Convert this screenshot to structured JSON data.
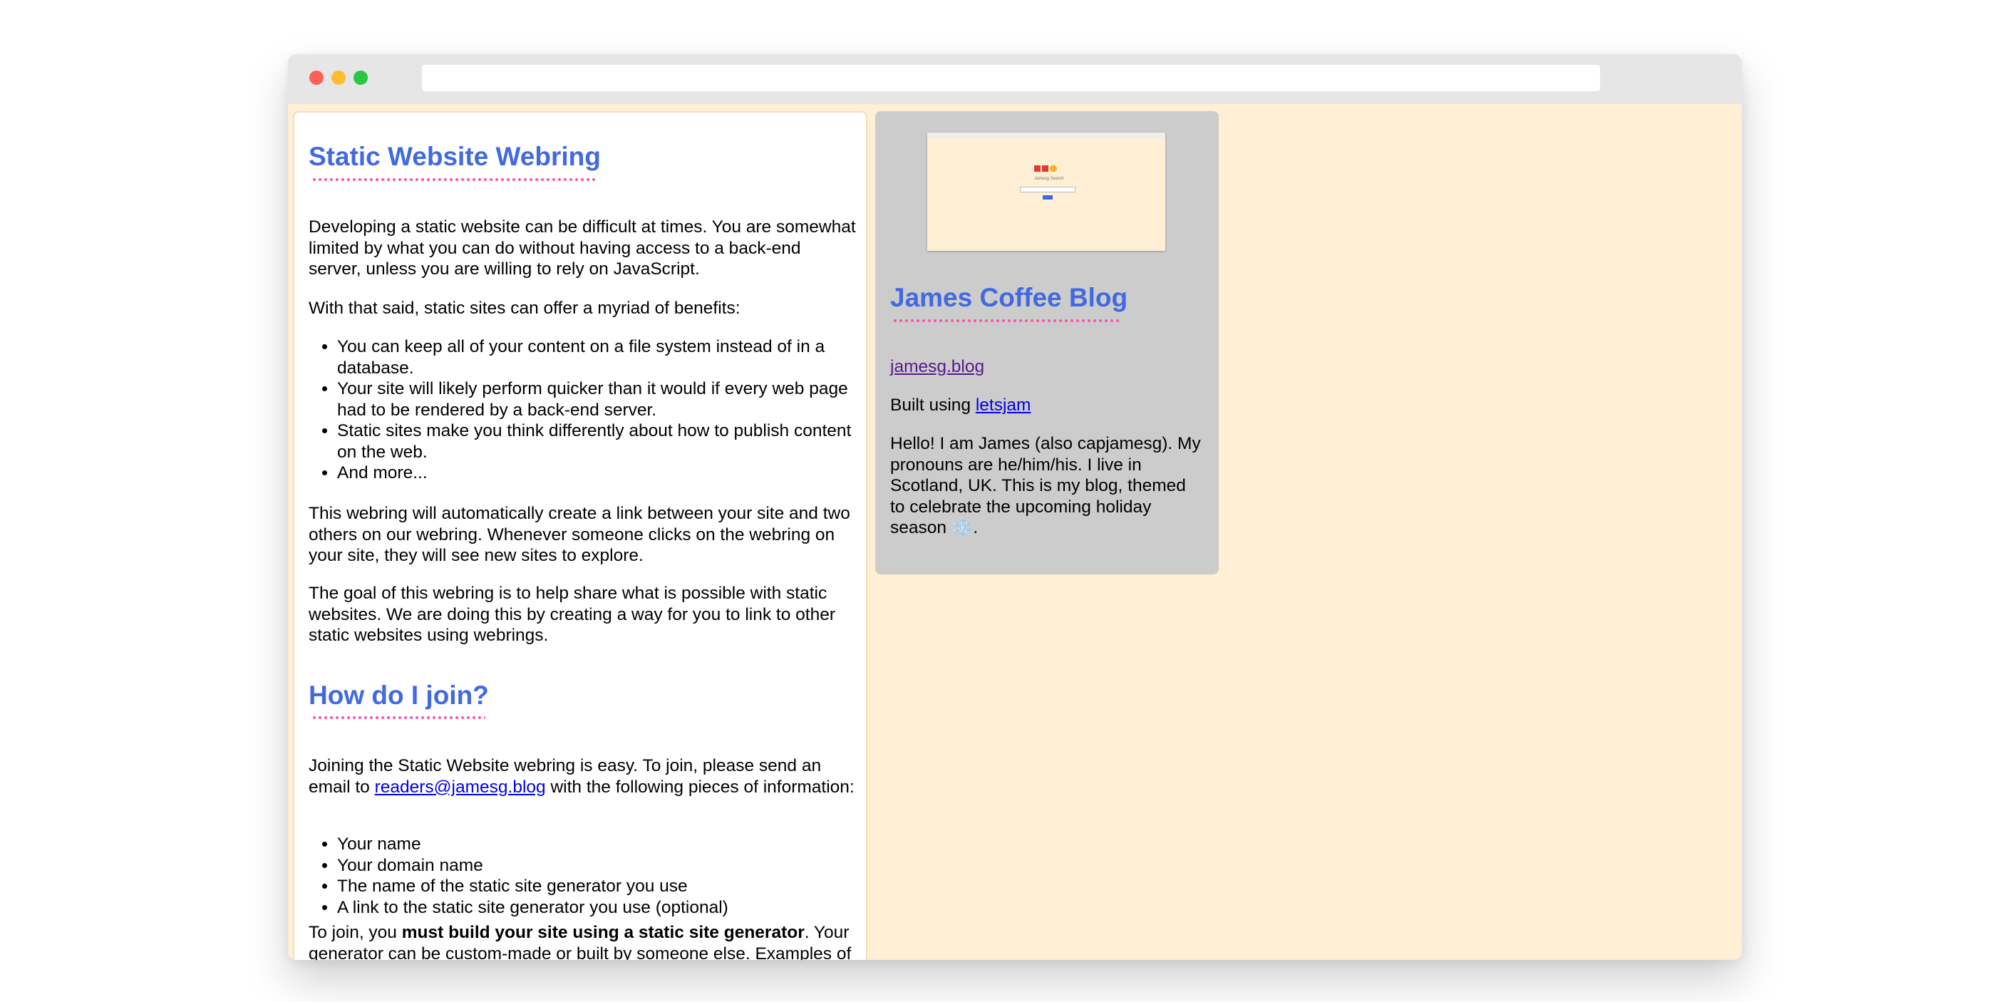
{
  "browser": {
    "address": ""
  },
  "main": {
    "title": "Static Website Webring",
    "intro": "Developing a static website can be difficult at times. You are somewhat limited by what you can do without having access to a back-end server, unless you are willing to rely on JavaScript.",
    "benefits_lead": "With that said, static sites can offer a myriad of benefits:",
    "benefits": [
      "You can keep all of your content on a file system instead of in a database.",
      "Your site will likely perform quicker than it would if every web page had to be rendered by a back-end server.",
      "Static sites make you think differently about how to publish content on the web.",
      "And more..."
    ],
    "webring_para": "This webring will automatically create a link between your site and two others on our webring. Whenever someone clicks on the webring on your site, they will see new sites to explore.",
    "goal_para": "The goal of this webring is to help share what is possible with static websites. We are doing this by creating a way for you to link to other static websites using webrings.",
    "join_title": "How do I join?",
    "join_lead_before": "Joining the Static Website webring is easy. To join, please send an email to ",
    "join_email": "readers@jamesg.blog",
    "join_lead_after": " with the following pieces of information:",
    "join_items": [
      "Your name",
      "Your domain name",
      "The name of the static site generator you use",
      "A link to the static site generator you use (optional)"
    ],
    "req_before": "To join, you ",
    "req_bold": "must build your site using a static site generator",
    "req_after": ". Your generator can be custom-made or built by someone else. Examples of"
  },
  "side": {
    "title": "James Coffee Blog",
    "domain": "jamesg.blog",
    "built_prefix": "Built using ",
    "built_link": "letsjam",
    "bio": "Hello! I am James (also capjamesg). My pronouns are he/him/his. I live in Scotland, UK. This is my blog, themed to celebrate the upcoming holiday season",
    "snowflake": "❄️",
    "bio_end": ".",
    "thumbnail_title": "Jamesg Search"
  },
  "colors": {
    "heading": "#4169e1",
    "underline_dots": "#ff4fa3",
    "page_bg": "#feefd5",
    "side_card": "#cccccc",
    "link": "#0000ee",
    "visited_link": "#551a8b"
  }
}
